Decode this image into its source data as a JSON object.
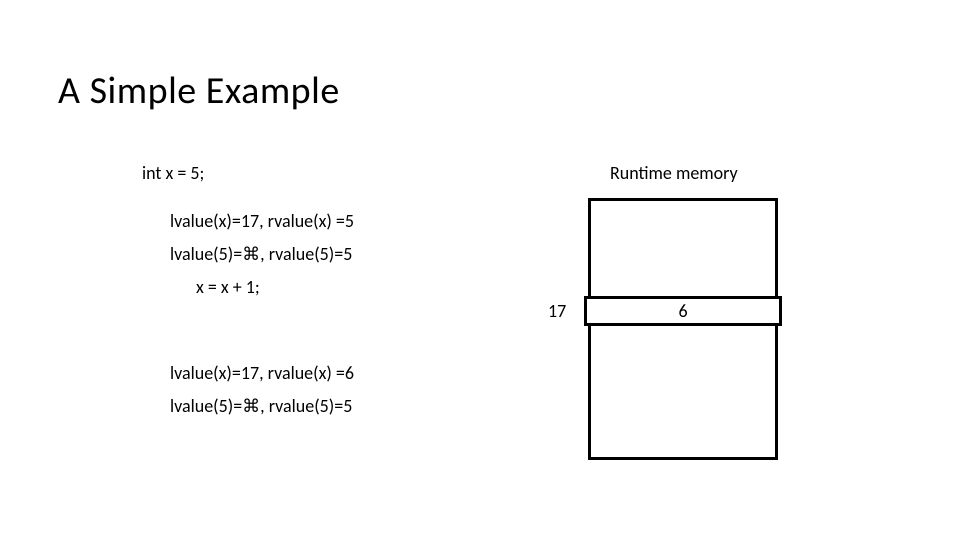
{
  "title": "A Simple Example",
  "decl": "int x = 5;",
  "lines": {
    "l1": "lvalue(x)=17, rvalue(x) =5",
    "l2": "lvalue(5)=⌘, rvalue(5)=5",
    "stmt": "x = x + 1;",
    "l3": "lvalue(x)=17, rvalue(x) =6",
    "l4": "lvalue(5)=⌘, rvalue(5)=5"
  },
  "memory": {
    "label": "Runtime memory",
    "addr": "17",
    "cell_value": "6"
  }
}
